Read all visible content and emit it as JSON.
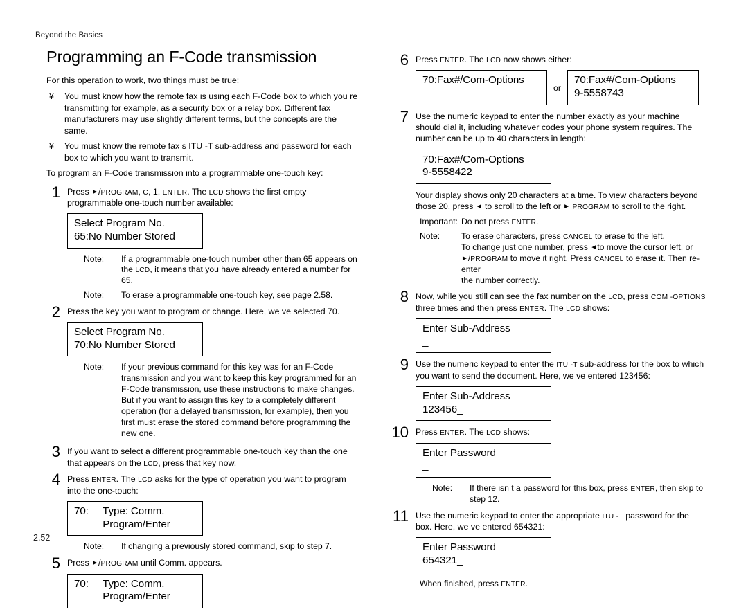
{
  "running_head": "Beyond the Basics",
  "folio": "2.52",
  "title": "Programming an F-Code transmission",
  "intro": "For this operation to work, two things must be true:",
  "bullet_mark": "¥",
  "bullets": [
    "You must know how the remote fax is using each F-Code box to which you re transmitting   for example, as a security box or a relay box. Different fax manufacturers may use slightly different terms, but the concepts are the same.",
    "You must know the remote fax s  ITU -T  sub-address and password for each box to which you want to transmit."
  ],
  "lead_in": "To program an F-Code transmission into a programmable one-touch key:",
  "keys": {
    "program": "PROGRAM",
    "enter": "ENTER",
    "cancel": "CANCEL",
    "lcd": "LCD",
    "com_options_1": "COM",
    "com_options_2": "-OPTIONS",
    "itu": "ITU",
    "itu_t": "-T",
    "c": "C",
    "one": "1",
    "right_tri": "►",
    "left_tri": "◄",
    "slash": "/"
  },
  "steps": {
    "s1": {
      "num": "1",
      "text_a": "Press ",
      "text_b": ", ",
      "text_c": ", ",
      "text_d": ". The ",
      "text_e": " shows the first empty programmable one-touch number available:",
      "lcd_line1": "Select Program No.",
      "lcd_line2": "65:No Number Stored",
      "note1_label": "Note:",
      "note1_a": "If a programmable one-touch number other than    65 appears on the ",
      "note1_b": ", it means that you have already entered a number for     65.",
      "note2_label": "Note:",
      "note2_text": "To erase a programmable one-touch key, see page 2.58."
    },
    "s2": {
      "num": "2",
      "text": "Press the key you want to program or change. Here, we ve selected    70.",
      "lcd_line1": "Select Program No.",
      "lcd_line2": "70:No Number Stored",
      "note_label": "Note:",
      "note_text": "If your previous command for this key was for an F-Code transmission and you want to keep this key programmed for an F-Code transmission, use these instructions to make changes. But if you want to assign this key to a completely different operation (for a delayed transmission, for example), then you first must erase the stored command before programming the new one."
    },
    "s3": {
      "num": "3",
      "text_a": "If you want to select a different programmable one-touch key than the one that appears on the  ",
      "text_b": ", press that key now."
    },
    "s4": {
      "num": "4",
      "text_a": "Press ",
      "text_b": ". The ",
      "text_c": " asks for the type of operation you want to program into the one-touch:",
      "lcd_line1": "70:     Type: Comm.",
      "lcd_line2": "          Program/Enter",
      "note_label": "Note:",
      "note_text": "If changing a previously stored command, skip to step 7."
    },
    "s5": {
      "num": "5",
      "text_a": "Press ",
      "text_b": " until   Comm.  appears.",
      "lcd_line1": "70:     Type: Comm.",
      "lcd_line2": "          Program/Enter"
    },
    "s6": {
      "num": "6",
      "text_a": "Press ",
      "text_b": ". The ",
      "text_c": " now shows either:",
      "lcd_a_line1": "70:Fax#/Com-Options",
      "lcd_a_line2": "_",
      "or": "or",
      "lcd_b_line1": "70:Fax#/Com-Options",
      "lcd_b_line2": "9-5558743_"
    },
    "s7": {
      "num": "7",
      "text": "Use the numeric keypad to enter the number    exactly as your machine should dial it, including whatever codes your phone system requires. The number can be up to 40 characters in length:",
      "lcd_line1": "70:Fax#/Com-Options",
      "lcd_line2": "9-5558422_",
      "para_a": "Your display shows only 20 characters at a time. To view characters beyond those 20, press ",
      "para_b": " to scroll to the left or   ",
      "para_c": " to scroll to the right.",
      "important_label": "Important:",
      "important_a": "Do not  press ",
      "important_b": ".",
      "note_label": "Note:",
      "note_l1_a": "To erase characters, press ",
      "note_l1_b": " to erase to the left.",
      "note_l2_a": "To change just one number, press  ",
      "note_l2_b": "to move the cursor left, or",
      "note_l3_a": " to move it right. Press  ",
      "note_l3_b": " to erase it. Then re-enter",
      "note_l4": "the number correctly."
    },
    "s8": {
      "num": "8",
      "text_a": "Now, while you still can see the fax number on the  ",
      "text_b": ", press ",
      "text_c": " three times and then press ",
      "text_d": ". The ",
      "text_e": " shows:",
      "lcd_line1": "Enter Sub-Address",
      "lcd_line2": "_"
    },
    "s9": {
      "num": "9",
      "text_a": "Use the numeric keypad to enter the  ",
      "text_b": " sub-address for the box to which you want to send the document. Here, we ve entered    123456:",
      "lcd_line1": "Enter Sub-Address",
      "lcd_line2": "123456_"
    },
    "s10": {
      "num": "10",
      "text_a": "Press ",
      "text_b": ". The ",
      "text_c": " shows:",
      "lcd_line1": "Enter Password",
      "lcd_line2": "_",
      "note_label": "Note:",
      "note_a": "If there isn t a password for this box, press  ",
      "note_b": ", then skip to step 12."
    },
    "s11": {
      "num": "11",
      "text_a": "Use the numeric keypad to enter the appropriate  ",
      "text_b": " password for the box. Here, we ve entered 654321:",
      "lcd_line1": "Enter Password",
      "lcd_line2": "654321_",
      "closing_a": "When finished, press  ",
      "closing_b": "."
    }
  }
}
